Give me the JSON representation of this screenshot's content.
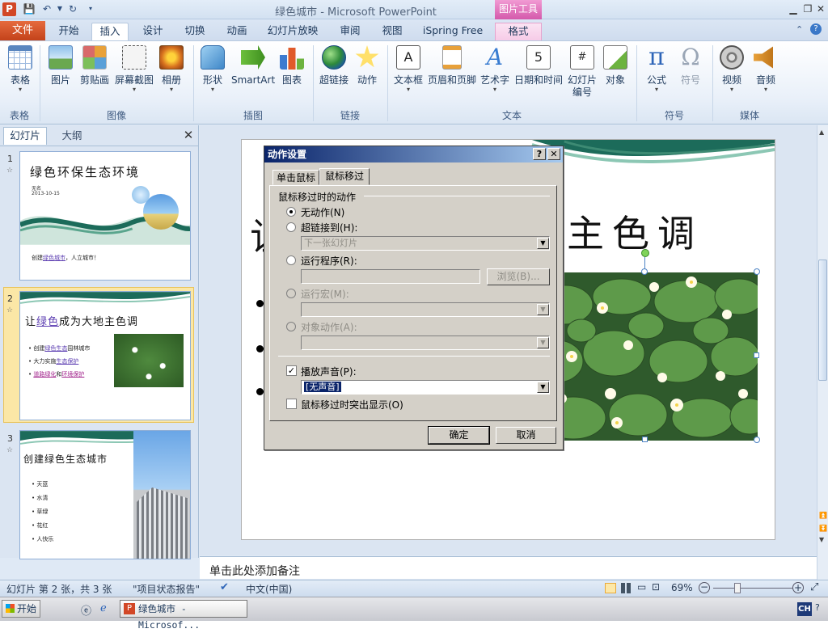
{
  "window": {
    "title": "绿色城市 - Microsoft PowerPoint",
    "picture_tools": "图片工具",
    "app_logo": "P"
  },
  "tabs": [
    "文件",
    "开始",
    "插入",
    "设计",
    "切换",
    "动画",
    "幻灯片放映",
    "审阅",
    "视图",
    "iSpring Free",
    "格式"
  ],
  "ribbon": {
    "groups": {
      "tables": "表格",
      "images": "图像",
      "illustrations": "插图",
      "links": "链接",
      "text": "文本",
      "symbols": "符号",
      "media": "媒体"
    },
    "buttons": {
      "table": "表格",
      "picture": "图片",
      "clipart": "剪贴画",
      "screenshot": "屏幕截图",
      "album": "相册",
      "shapes": "形状",
      "smartart": "SmartArt",
      "chart": "图表",
      "hyperlink": "超链接",
      "action": "动作",
      "textbox": "文本框",
      "header_footer": "页眉和页脚",
      "wordart": "艺术字",
      "datetime": "日期和时间",
      "slide_number_1": "幻灯片",
      "slide_number_2": "编号",
      "object": "对象",
      "equation": "公式",
      "symbol": "符号",
      "video": "视频",
      "audio": "音频"
    }
  },
  "panel": {
    "tab_slides": "幻灯片",
    "tab_outline": "大纲",
    "close": "✕",
    "slides": [
      {
        "num": "1",
        "title": "绿色环保生态环境",
        "author": "无名",
        "date": "2013-10-15",
        "footer_1": "创建",
        "footer_link": "绿色城市",
        "footer_2": "，人立城市！"
      },
      {
        "num": "2",
        "title_1": "让",
        "title_link": "绿色",
        "title_2": "成为大地主色调",
        "b1_1": "创建",
        "b1_link": "绿色生态",
        "b1_2": "园林城市",
        "b2_1": "大力实施",
        "b2_link": "生态保护",
        "b3_link": "道路绿化",
        "b3_2": "和",
        "b3_link2": "环境保护"
      },
      {
        "num": "3",
        "title": "创建绿色生态城市",
        "items": [
          "天蓝",
          "水清",
          "草绿",
          "花红",
          "人快乐"
        ]
      }
    ]
  },
  "slide_main": {
    "title_visible": "主色调"
  },
  "notes": {
    "placeholder": "单击此处添加备注"
  },
  "dialog": {
    "title": "动作设置",
    "help": "?",
    "close": "✕",
    "tab_click": "单击鼠标",
    "tab_hover": "鼠标移过",
    "section": "鼠标移过时的动作",
    "opt_none": "无动作(N)",
    "opt_hyperlink": "超链接到(H):",
    "hyperlink_value": "下一张幻灯片",
    "opt_program": "运行程序(R):",
    "browse": "浏览(B)...",
    "opt_macro": "运行宏(M):",
    "opt_object": "对象动作(A):",
    "play_sound": "播放声音(P):",
    "sound_value": "[无声音]",
    "highlight": "鼠标移过时突出显示(O)",
    "ok": "确定",
    "cancel": "取消"
  },
  "status": {
    "slide_info": "幻灯片 第 2 张，共 3 张",
    "theme": "\"项目状态报告\"",
    "language": "中文(中国)",
    "zoom": "69%"
  },
  "taskbar": {
    "start": "开始",
    "app": "绿色城市 - Microsof...",
    "ime": "CH"
  }
}
